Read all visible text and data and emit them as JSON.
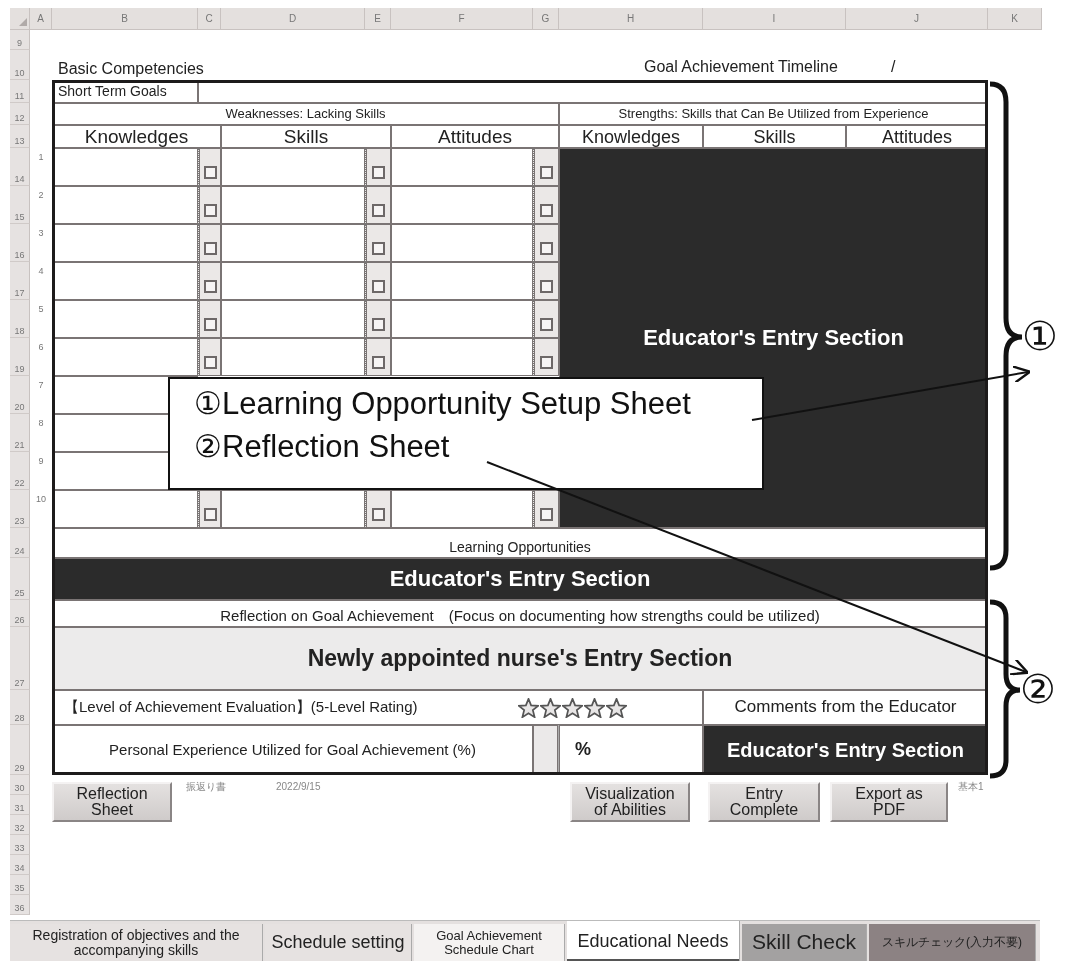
{
  "column_headers": [
    "A",
    "B",
    "C",
    "D",
    "E",
    "F",
    "G",
    "H",
    "I",
    "J",
    "K"
  ],
  "row_headers": [
    "9",
    "10",
    "11",
    "12",
    "13",
    "14",
    "15",
    "16",
    "17",
    "18",
    "19",
    "20",
    "21",
    "22",
    "23",
    "24",
    "25",
    "26",
    "27",
    "28",
    "29",
    "30",
    "31",
    "32",
    "33",
    "34",
    "35",
    "36"
  ],
  "sheet": {
    "title": "Basic Competencies",
    "timeline_label": "Goal Achievement Timeline",
    "timeline_value": "/",
    "short_term_goals_label": "Short Term Goals",
    "weaknesses": {
      "title": "Weaknesses: Lacking Skills",
      "columns": [
        "Knowledges",
        "Skills",
        "Attitudes"
      ]
    },
    "strengths": {
      "title": "Strengths: Skills that Can Be Utilized from Experience",
      "columns": [
        "Knowledges",
        "Skills",
        "Attitudes"
      ],
      "entry": "Educator's Entry Section"
    },
    "goal_rows": [
      {
        "number": "1",
        "checkboxes": [
          {
            "checked": false
          },
          {
            "checked": false
          },
          {
            "checked": false
          }
        ]
      },
      {
        "number": "2",
        "checkboxes": [
          {
            "checked": false
          },
          {
            "checked": false
          },
          {
            "checked": false
          }
        ]
      },
      {
        "number": "3",
        "checkboxes": [
          {
            "checked": false
          },
          {
            "checked": false
          },
          {
            "checked": false
          }
        ]
      },
      {
        "number": "4",
        "checkboxes": [
          {
            "checked": false
          },
          {
            "checked": false
          },
          {
            "checked": false
          }
        ]
      },
      {
        "number": "5",
        "checkboxes": [
          {
            "checked": false
          },
          {
            "checked": false
          },
          {
            "checked": false
          }
        ]
      },
      {
        "number": "6",
        "checkboxes": [
          {
            "checked": false
          },
          {
            "checked": false
          },
          {
            "checked": false
          }
        ]
      },
      {
        "number": "7"
      },
      {
        "number": "8"
      },
      {
        "number": "9"
      },
      {
        "number": "10",
        "checkboxes": [
          {
            "checked": false
          },
          {
            "checked": false
          },
          {
            "checked": false
          }
        ]
      }
    ],
    "learning_opportunities": {
      "label": "Learning Opportunities",
      "entry": "Educator's Entry Section"
    },
    "reflection": {
      "label": "Reflection on Goal Achievement　(Focus on documenting how strengths could be utilized)",
      "entry": "Newly appointed nurse's Entry Section"
    },
    "evaluation": {
      "label": "【Level of Achievement Evaluation】(5-Level Rating)",
      "stars": 0,
      "comments_label": "Comments from the Educator"
    },
    "experience": {
      "label": "Personal Experience Utilized for Goal Achievement (%)",
      "unit": "%",
      "comments_entry": "Educator's Entry Section"
    }
  },
  "left_controls": [
    {
      "kind": "button",
      "label": "Reflection\nSheet"
    },
    {
      "kind": "note",
      "text": "振返り書"
    },
    {
      "kind": "note",
      "text": "2022/9/15"
    }
  ],
  "right_controls": [
    {
      "kind": "button",
      "label": "Visualization\nof Abilities"
    },
    {
      "kind": "button",
      "label": "Entry\nComplete"
    },
    {
      "kind": "button",
      "label": "Export as\nPDF"
    },
    {
      "kind": "note",
      "text": "基本1"
    }
  ],
  "callout": {
    "lines": [
      "①Learning Opportunity Setup Sheet",
      "②Reflection Sheet"
    ]
  },
  "markers": [
    "①",
    "②"
  ],
  "sheet_tabs": [
    {
      "label": "Registration of objectives and the\naccompanying skills",
      "selected": false,
      "color": "#e6e2e1"
    },
    {
      "label": "Schedule setting",
      "selected": false,
      "color": "#e6e2e1"
    },
    {
      "label": "Goal Achievement\nSchedule Chart",
      "selected": false,
      "color": "#f4f2f1"
    },
    {
      "label": "Educational Needs",
      "selected": true,
      "color": "#ffffff"
    },
    {
      "label": "Skill Check",
      "selected": false,
      "color": "#a3a1a1"
    },
    {
      "label": "スキルチェック(入力不要)",
      "selected": false,
      "color": "#8c8283"
    }
  ]
}
